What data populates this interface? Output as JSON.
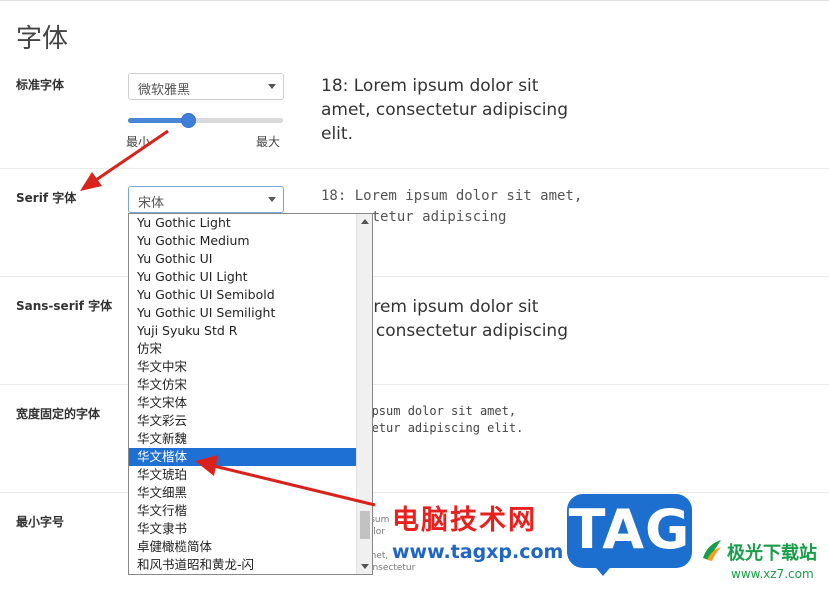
{
  "page": {
    "title": "字体"
  },
  "sections": {
    "standard": {
      "label": "标准字体",
      "value": "微软雅黑",
      "preview": "18: Lorem ipsum dolor sit amet, consectetur adipiscing elit."
    },
    "size_slider": {
      "min_label": "最小",
      "max_label": "最大",
      "level_percent": 39
    },
    "serif": {
      "label": "Serif 字体",
      "value": "宋体",
      "preview": "18: Lorem ipsum dolor sit amet, consectetur adipiscing"
    },
    "sans_serif": {
      "label": "Sans-serif 字体",
      "preview": "18: Lorem ipsum dolor sit amet, consectetur adipiscing"
    },
    "fixed_width": {
      "label": "宽度固定的字体",
      "preview": "Lorem ipsum dolor sit amet, consectetur adipiscing elit."
    },
    "min_size": {
      "label": "最小字号",
      "preview": "ipsum dolor sit amet, consectetur"
    }
  },
  "dropdown": {
    "items": [
      "Yu Gothic Light",
      "Yu Gothic Medium",
      "Yu Gothic UI",
      "Yu Gothic UI Light",
      "Yu Gothic UI Semibold",
      "Yu Gothic UI Semilight",
      "Yuji Syuku Std R",
      "仿宋",
      "华文中宋",
      "华文仿宋",
      "华文宋体",
      "华文彩云",
      "华文新魏",
      "华文楷体",
      "华文琥珀",
      "华文细黑",
      "华文行楷",
      "华文隶书",
      "卓健橄榄简体",
      "和风书道昭和黄龙-闪"
    ],
    "selected": "华文楷体"
  },
  "watermark": {
    "site_name_cn": "电脑技术网",
    "site_url": "www.tagxp.com",
    "tag_logo": "TAG",
    "site2_name_cn": "极光下载站",
    "site2_url": "www.xz7.com"
  },
  "colors": {
    "accent": "#1e70d4",
    "annotation_arrow": "#d9221c",
    "watermark_red": "#e8201e",
    "watermark_blue": "#1d6fcf",
    "watermark_green": "#1a9d4a"
  },
  "icons": {
    "select_caret": "chevron-down-icon",
    "scroll_up": "arrow-up-icon",
    "scroll_down": "arrow-down-icon"
  }
}
